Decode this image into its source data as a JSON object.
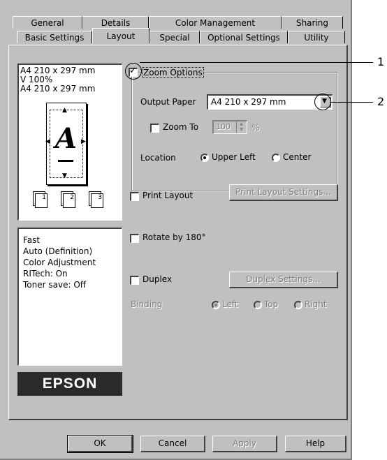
{
  "tabs_row1": [
    "General",
    "Details",
    "Color Management",
    "Sharing"
  ],
  "tabs_row2": [
    "Basic Settings",
    "Layout",
    "Special",
    "Optional Settings",
    "Utility"
  ],
  "preview": {
    "paper_line": "A4 210 x 297 mm",
    "zoom_line": "V 100%",
    "output_line": "A4 210 x 297 mm",
    "letter": "A",
    "page_numbers": [
      "1",
      "2",
      "3"
    ]
  },
  "zoom_options": {
    "label": "Zoom Options",
    "checked": true,
    "output_paper_label": "Output Paper",
    "output_paper_value": "A4 210 x 297 mm",
    "zoom_to_label": "Zoom To",
    "zoom_to_value": "100",
    "zoom_to_unit": "%",
    "location_label": "Location",
    "upper_left_label": "Upper Left",
    "center_label": "Center"
  },
  "print_layout": {
    "label": "Print Layout",
    "settings_button": "Print Layout Settings..."
  },
  "rotate": {
    "label": "Rotate by 180°"
  },
  "duplex": {
    "label": "Duplex",
    "settings_button": "Duplex Settings...",
    "binding_label": "Binding",
    "left_label": "Left",
    "top_label": "Top",
    "right_label": "Right"
  },
  "info_lines": [
    "Fast",
    "Auto (Definition)",
    "Color Adjustment",
    "RITech: On",
    "Toner save: Off"
  ],
  "brand": "EPSON",
  "buttons": {
    "ok": "OK",
    "cancel": "Cancel",
    "apply": "Apply",
    "help": "Help"
  },
  "callouts": [
    "1",
    "2"
  ]
}
